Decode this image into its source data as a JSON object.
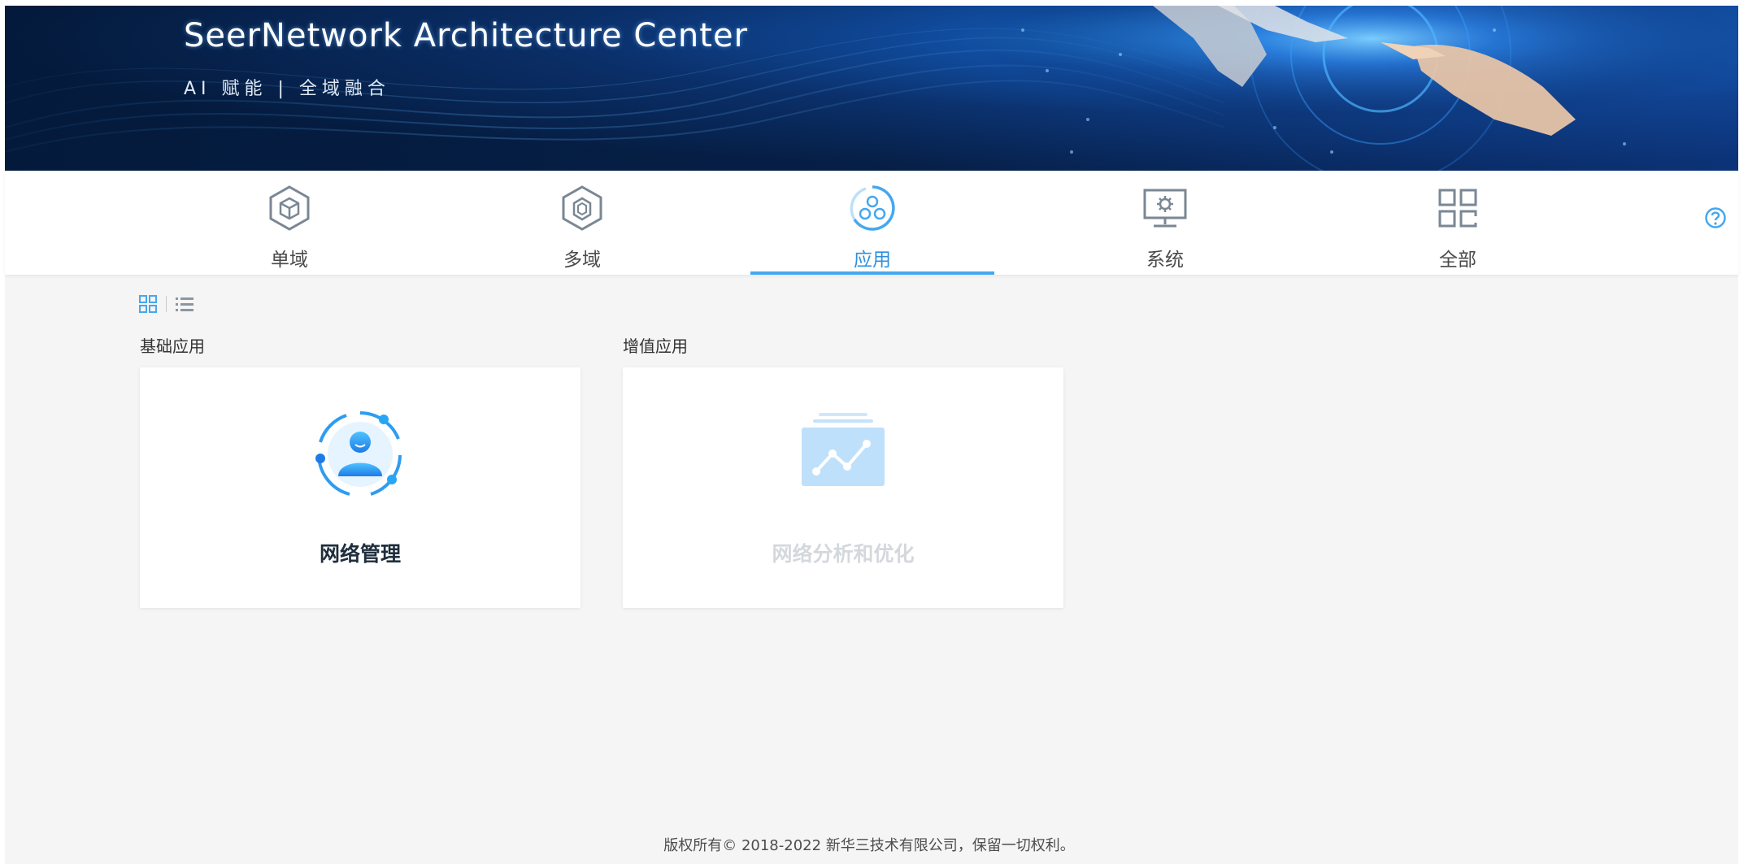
{
  "banner": {
    "title": "SeerNetwork Architecture Center",
    "subtitle": "AI 赋能 | 全域融合"
  },
  "nav": {
    "items": [
      {
        "label": "单域",
        "icon": "cube-hexagon-icon"
      },
      {
        "label": "多域",
        "icon": "layers-hexagon-icon"
      },
      {
        "label": "应用",
        "icon": "app-cluster-icon",
        "active": true
      },
      {
        "label": "系统",
        "icon": "monitor-gear-icon"
      },
      {
        "label": "全部",
        "icon": "grid-four-icon"
      }
    ],
    "help_icon": "question-circle-icon"
  },
  "view_toggle": {
    "grid_icon": "grid-view-icon",
    "list_icon": "list-view-icon",
    "active": "grid"
  },
  "sections": [
    {
      "title": "基础应用",
      "cards": [
        {
          "label": "网络管理",
          "icon": "user-network-icon",
          "enabled": true
        }
      ]
    },
    {
      "title": "增值应用",
      "cards": [
        {
          "label": "网络分析和优化",
          "icon": "chart-analysis-icon",
          "enabled": false
        }
      ]
    }
  ],
  "footer": {
    "text": "版权所有© 2018-2022 新华三技术有限公司，保留一切权利。"
  },
  "colors": {
    "accent": "#46a7ef",
    "active_text": "#2e8fe0",
    "icon_gray": "#7a8794",
    "background": "#f5f5f5"
  }
}
